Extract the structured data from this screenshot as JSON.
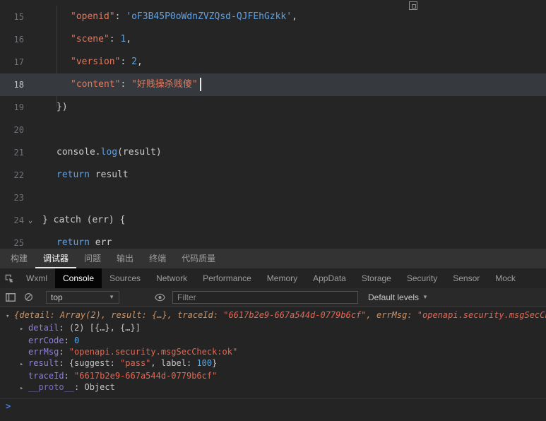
{
  "editor": {
    "lines": [
      {
        "num": "15",
        "indent": 2,
        "hl": false,
        "fold": "",
        "cursor": false,
        "tokens": [
          {
            "c": "key",
            "t": "\"openid\""
          },
          {
            "c": "pln",
            "t": ": "
          },
          {
            "c": "blue",
            "t": "'oF3B45P0oWdnZVZQsd-QJFEhGzkk'"
          },
          {
            "c": "pln",
            "t": ","
          }
        ]
      },
      {
        "num": "16",
        "indent": 2,
        "hl": false,
        "fold": "",
        "cursor": false,
        "tokens": [
          {
            "c": "key",
            "t": "\"scene\""
          },
          {
            "c": "pln",
            "t": ": "
          },
          {
            "c": "blue",
            "t": "1"
          },
          {
            "c": "pln",
            "t": ","
          }
        ]
      },
      {
        "num": "17",
        "indent": 2,
        "hl": false,
        "fold": "",
        "cursor": false,
        "tokens": [
          {
            "c": "key",
            "t": "\"version\""
          },
          {
            "c": "pln",
            "t": ": "
          },
          {
            "c": "blue",
            "t": "2"
          },
          {
            "c": "pln",
            "t": ","
          }
        ]
      },
      {
        "num": "18",
        "indent": 2,
        "hl": true,
        "fold": "",
        "cursor": true,
        "tokens": [
          {
            "c": "key",
            "t": "\"content\""
          },
          {
            "c": "pln",
            "t": ": "
          },
          {
            "c": "key",
            "t": "\"好贱操杀贱傻\""
          }
        ]
      },
      {
        "num": "19",
        "indent": 1,
        "hl": false,
        "fold": "",
        "cursor": false,
        "tokens": [
          {
            "c": "pln",
            "t": "})"
          }
        ]
      },
      {
        "num": "20",
        "indent": 0,
        "hl": false,
        "fold": "",
        "cursor": false,
        "tokens": []
      },
      {
        "num": "21",
        "indent": 1,
        "hl": false,
        "fold": "",
        "cursor": false,
        "tokens": [
          {
            "c": "pln",
            "t": "console."
          },
          {
            "c": "blue",
            "t": "log"
          },
          {
            "c": "pln",
            "t": "(result)"
          }
        ]
      },
      {
        "num": "22",
        "indent": 1,
        "hl": false,
        "fold": "",
        "cursor": false,
        "tokens": [
          {
            "c": "blue",
            "t": "return"
          },
          {
            "c": "pln",
            "t": " result"
          }
        ]
      },
      {
        "num": "23",
        "indent": 0,
        "hl": false,
        "fold": "",
        "cursor": false,
        "tokens": []
      },
      {
        "num": "24",
        "indent": 0,
        "hl": false,
        "fold": "⌄",
        "cursor": false,
        "tokens": [
          {
            "c": "pln",
            "t": "} catch (err) {"
          }
        ]
      },
      {
        "num": "25",
        "indent": 1,
        "hl": false,
        "fold": "",
        "cursor": false,
        "tokens": [
          {
            "c": "blue",
            "t": "return"
          },
          {
            "c": "pln",
            "t": " err"
          }
        ]
      }
    ]
  },
  "panel_tabs": {
    "items": [
      "构建",
      "调试器",
      "问题",
      "输出",
      "终端",
      "代码质量"
    ],
    "active": "调试器"
  },
  "devtools_tabs": {
    "items": [
      "Wxml",
      "Console",
      "Sources",
      "Network",
      "Performance",
      "Memory",
      "AppData",
      "Storage",
      "Security",
      "Sensor",
      "Mock"
    ],
    "active": "Console"
  },
  "console_toolbar": {
    "context_selector": "top",
    "filter_placeholder": "Filter",
    "log_level": "Default levels"
  },
  "console": {
    "preview_row": {
      "expanded_arrow": "▾",
      "tokens": [
        {
          "c": "pv",
          "t": "{detail: Array(2), result: {…}, traceId: "
        },
        {
          "c": "pvs",
          "t": "\"6617b2e9-667a544d-0779b6cf\""
        },
        {
          "c": "pv",
          "t": ", errMsg: "
        },
        {
          "c": "pvs",
          "t": "\"openapi.security.msgSecChec"
        }
      ]
    },
    "rows": [
      {
        "arrow": "▸",
        "tokens": [
          {
            "c": "ck",
            "t": "detail"
          },
          {
            "c": "cp",
            "t": ": "
          },
          {
            "c": "cp",
            "t": "(2) [{…}, {…}]"
          }
        ]
      },
      {
        "arrow": "",
        "tokens": [
          {
            "c": "ck",
            "t": "errCode"
          },
          {
            "c": "cp",
            "t": ": "
          },
          {
            "c": "cn",
            "t": "0"
          }
        ]
      },
      {
        "arrow": "",
        "tokens": [
          {
            "c": "ck",
            "t": "errMsg"
          },
          {
            "c": "cp",
            "t": ": "
          },
          {
            "c": "cs",
            "t": "\"openapi.security.msgSecCheck:ok\""
          }
        ]
      },
      {
        "arrow": "▸",
        "tokens": [
          {
            "c": "ck",
            "t": "result"
          },
          {
            "c": "cp",
            "t": ": "
          },
          {
            "c": "cp",
            "t": "{suggest: "
          },
          {
            "c": "cs",
            "t": "\"pass\""
          },
          {
            "c": "cp",
            "t": ", label: "
          },
          {
            "c": "cn",
            "t": "100"
          },
          {
            "c": "cp",
            "t": "}"
          }
        ]
      },
      {
        "arrow": "",
        "tokens": [
          {
            "c": "ck",
            "t": "traceId"
          },
          {
            "c": "cp",
            "t": ": "
          },
          {
            "c": "cs",
            "t": "\"6617b2e9-667a544d-0779b6cf\""
          }
        ]
      },
      {
        "arrow": "▸",
        "tokens": [
          {
            "c": "ckd",
            "t": "__proto__"
          },
          {
            "c": "cp",
            "t": ": "
          },
          {
            "c": "cp",
            "t": "Object"
          }
        ]
      }
    ],
    "prompt": ">"
  }
}
